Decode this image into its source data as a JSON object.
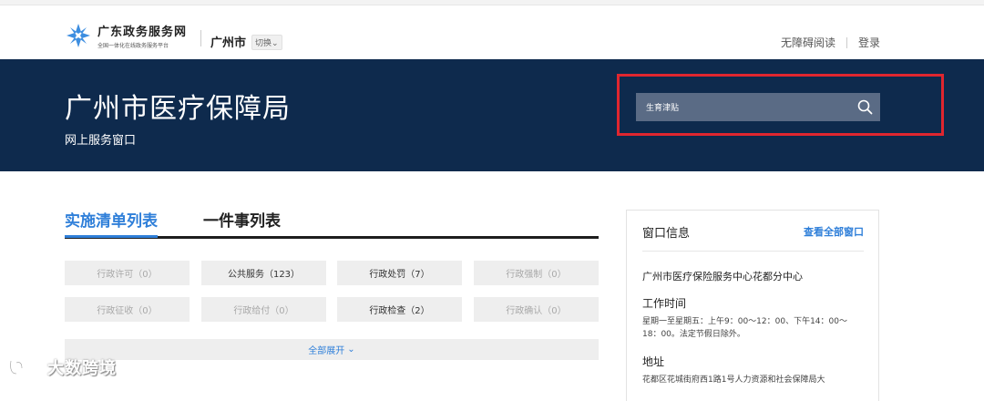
{
  "header": {
    "logo_title": "广东政务服务网",
    "logo_subtitle": "全国一体化在线政务服务平台",
    "city": "广州市",
    "switch_label": "切换",
    "accessibility_label": "无障碍阅读",
    "login_label": "登录"
  },
  "banner": {
    "title": "广州市医疗保障局",
    "subtitle": "网上服务窗口",
    "search_value": "生育津贴"
  },
  "tabs": [
    {
      "label": "实施清单列表",
      "active": true
    },
    {
      "label": "一件事列表",
      "active": false
    }
  ],
  "categories": [
    {
      "label": "行政许可（0）",
      "enabled": false
    },
    {
      "label": "公共服务（123）",
      "enabled": true
    },
    {
      "label": "行政处罚（7）",
      "enabled": true
    },
    {
      "label": "行政强制（0）",
      "enabled": false
    },
    {
      "label": "行政征收（0）",
      "enabled": false
    },
    {
      "label": "行政给付（0）",
      "enabled": false
    },
    {
      "label": "行政检查（2）",
      "enabled": true
    },
    {
      "label": "行政确认（0）",
      "enabled": false
    }
  ],
  "expand_label": "全部展开",
  "window_panel": {
    "title": "窗口信息",
    "view_all_link": "查看全部窗口",
    "name": "广州市医疗保险服务中心花都分中心",
    "hours_label": "工作时间",
    "hours_text": "星期一至星期五：上午9：00～12：00、下午14：00～18：00。法定节假日除外。",
    "address_label": "地址",
    "address_text": "花都区花城街府西1路1号人力资源和社会保障局大"
  },
  "watermark": "大数跨境",
  "colors": {
    "banner": "#0e2a4d",
    "accent": "#2f7fd9",
    "highlight": "#e0262f"
  }
}
